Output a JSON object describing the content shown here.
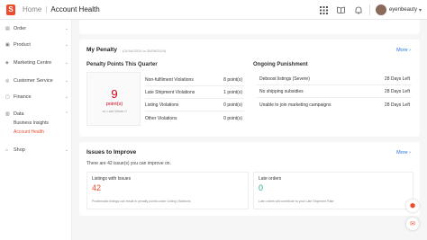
{
  "header": {
    "logo": "S",
    "breadcrumb_home": "Home",
    "breadcrumb_separator": "|",
    "breadcrumb_page": "Account Health",
    "icons": [
      "grid-icon",
      "book-icon",
      "bell-icon"
    ],
    "username": "eyenbeauty",
    "caret": "▾"
  },
  "sidebar": {
    "items": [
      {
        "label": "Order",
        "icon": "clipboard-icon",
        "chevron": "⌄"
      },
      {
        "label": "Product",
        "icon": "box-icon",
        "chevron": "⌄"
      },
      {
        "label": "Marketing Centre",
        "icon": "tag-icon",
        "chevron": "⌄"
      },
      {
        "label": "Customer Service",
        "icon": "headset-icon",
        "chevron": "⌄"
      },
      {
        "label": "Finance",
        "icon": "wallet-icon",
        "chevron": "⌄"
      },
      {
        "label": "Data",
        "icon": "chart-icon",
        "chevron": "⌃"
      },
      {
        "label": "Shop",
        "icon": "shop-icon",
        "chevron": "⌄"
      }
    ],
    "data_subitems": [
      {
        "label": "Business Insights",
        "active": false
      },
      {
        "label": "Account Health",
        "active": true
      }
    ]
  },
  "penalty": {
    "title": "My Penalty",
    "date_range": "(01/04/2024 to 30/06/2024)",
    "more": "More",
    "points_title": "Penalty Points This Quarter",
    "points_value": "9",
    "points_unit": "point(s)",
    "points_sub": "vs Last Week 0",
    "violations": [
      {
        "label": "Non-fulfilment Violations",
        "value": "8 point(s)"
      },
      {
        "label": "Late Shipment Violations",
        "value": "1 point(s)"
      },
      {
        "label": "Listing Violations",
        "value": "0 point(s)"
      },
      {
        "label": "Other Violations",
        "value": "0 point(s)"
      }
    ],
    "punishment_title": "Ongoing Punishment",
    "punishments": [
      {
        "label": "Deboost listings (Severe)",
        "value": "28 Days Left"
      },
      {
        "label": "No shipping subsidies",
        "value": "28 Days Left"
      },
      {
        "label": "Unable to join marketing campaigns",
        "value": "28 Days Left"
      }
    ]
  },
  "issues": {
    "title": "Issues to Improve",
    "more": "More",
    "summary": "There are 42 issue(s) you can improve on.",
    "metrics": [
      {
        "label": "Listings with Issues",
        "value": "42",
        "color": "#ee4d2d",
        "desc": "Problematic listings can result in penalty points under Listing Violations"
      },
      {
        "label": "Late orders",
        "value": "0",
        "color": "#26aa99",
        "desc": "Late orders will contribute to your Late Shipment Rate"
      }
    ]
  },
  "colors": {
    "accent": "#ee4d2d",
    "link": "#2673dd",
    "danger": "#d0011b",
    "success": "#26aa99"
  }
}
